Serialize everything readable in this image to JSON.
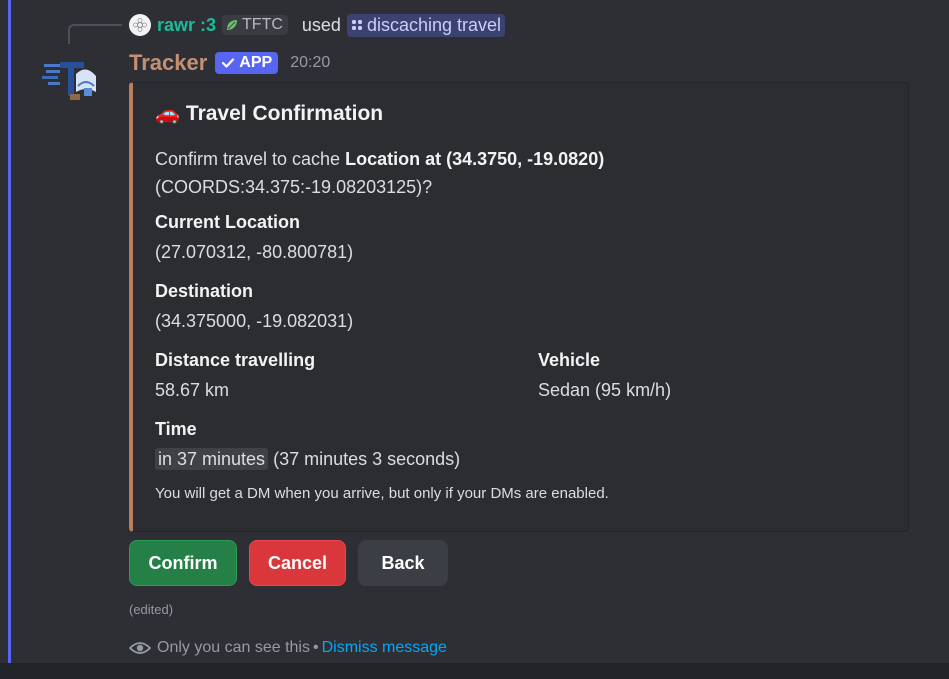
{
  "reply": {
    "username": "rawr :3",
    "tag": "TFTC",
    "used_text": "used",
    "command": "discaching travel"
  },
  "message": {
    "author": "Tracker",
    "badge": "APP",
    "timestamp": "20:20",
    "edited": "(edited)"
  },
  "embed": {
    "accent_color": "#b97e5f",
    "title_icon": "car-emoji",
    "title_emoji": "🚗",
    "title": "Travel Confirmation",
    "desc_prefix": "Confirm travel to cache ",
    "desc_bold": "Location at (34.3750, -19.0820)",
    "desc_suffix": "(COORDS:34.375:-19.08203125)?",
    "fields": {
      "current_location": {
        "name": "Current Location",
        "value": "(27.070312, -80.800781)"
      },
      "destination": {
        "name": "Destination",
        "value": "(34.375000, -19.082031)"
      },
      "distance": {
        "name": "Distance travelling",
        "value": "58.67 km"
      },
      "vehicle": {
        "name": "Vehicle",
        "value": "Sedan (95 km/h)"
      },
      "time": {
        "name": "Time",
        "relative": "in 37 minutes",
        "exact": "(37 minutes 3 seconds)"
      }
    },
    "footer": "You will get a DM when you arrive, but only if your DMs are enabled."
  },
  "buttons": {
    "confirm": "Confirm",
    "cancel": "Cancel",
    "back": "Back"
  },
  "ephemeral": {
    "notice": "Only you can see this",
    "separator": "•",
    "dismiss": "Dismiss message"
  },
  "colors": {
    "blurple": "#5865f2",
    "success": "#248046",
    "danger": "#da373c",
    "secondary": "#3c3e45",
    "link": "#00a8fc"
  }
}
